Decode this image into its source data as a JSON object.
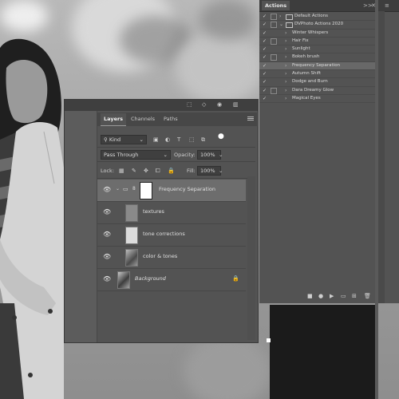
{
  "actions_panel": {
    "tab": "Actions",
    "controls": {
      "collapse": ">>",
      "menu": "≡"
    },
    "rows": [
      {
        "label": "Default Actions",
        "type": "set",
        "checked": true,
        "dialog": true,
        "expanded": false
      },
      {
        "label": "DVPhoto Actions 2020",
        "type": "set",
        "checked": true,
        "dialog": true,
        "expanded": true
      },
      {
        "label": "Winter Whispers",
        "type": "action",
        "checked": true,
        "dialog": false
      },
      {
        "label": "Hair Fix",
        "type": "action",
        "checked": true,
        "dialog": true
      },
      {
        "label": "Sunlight",
        "type": "action",
        "checked": true,
        "dialog": false
      },
      {
        "label": "Bokeh brush",
        "type": "action",
        "checked": true,
        "dialog": true
      },
      {
        "label": "Frequency Separation",
        "type": "action",
        "checked": true,
        "dialog": false,
        "selected": true
      },
      {
        "label": "Autumn Shift",
        "type": "action",
        "checked": true,
        "dialog": false
      },
      {
        "label": "Dodge and Burn",
        "type": "action",
        "checked": true,
        "dialog": false
      },
      {
        "label": "Dara Dreamy Glow",
        "type": "action",
        "checked": true,
        "dialog": true
      },
      {
        "label": "Magical Eyes",
        "type": "action",
        "checked": true,
        "dialog": false
      }
    ],
    "footer_icons": [
      "stop-icon",
      "record-icon",
      "play-icon",
      "new-set-icon",
      "new-action-icon",
      "delete-icon"
    ]
  },
  "layers_panel": {
    "tabs": [
      "Layers",
      "Channels",
      "Paths"
    ],
    "active_tab": "Layers",
    "filter_kind": "Kind",
    "blend_mode": "Pass Through",
    "opacity_label": "Opacity:",
    "opacity_value": "100%",
    "lock_label": "Lock:",
    "fill_label": "Fill:",
    "fill_value": "100%",
    "layers": [
      {
        "name": "Frequency Separation",
        "kind": "group",
        "visible": true,
        "selected": true
      },
      {
        "name": "textures",
        "kind": "pixel",
        "visible": true,
        "thumb_color": "#8a8a8a"
      },
      {
        "name": "tone corrections",
        "kind": "pixel",
        "visible": true,
        "thumb_color": "#dcdcdc"
      },
      {
        "name": "color & tones",
        "kind": "image",
        "visible": true
      },
      {
        "name": "Background",
        "kind": "background",
        "visible": true,
        "locked": true,
        "italic": true
      }
    ]
  },
  "colors": {
    "panel_bg": "#535353",
    "selected_row": "#6d6d6d",
    "dark_canvas": "#1b1b1b"
  }
}
